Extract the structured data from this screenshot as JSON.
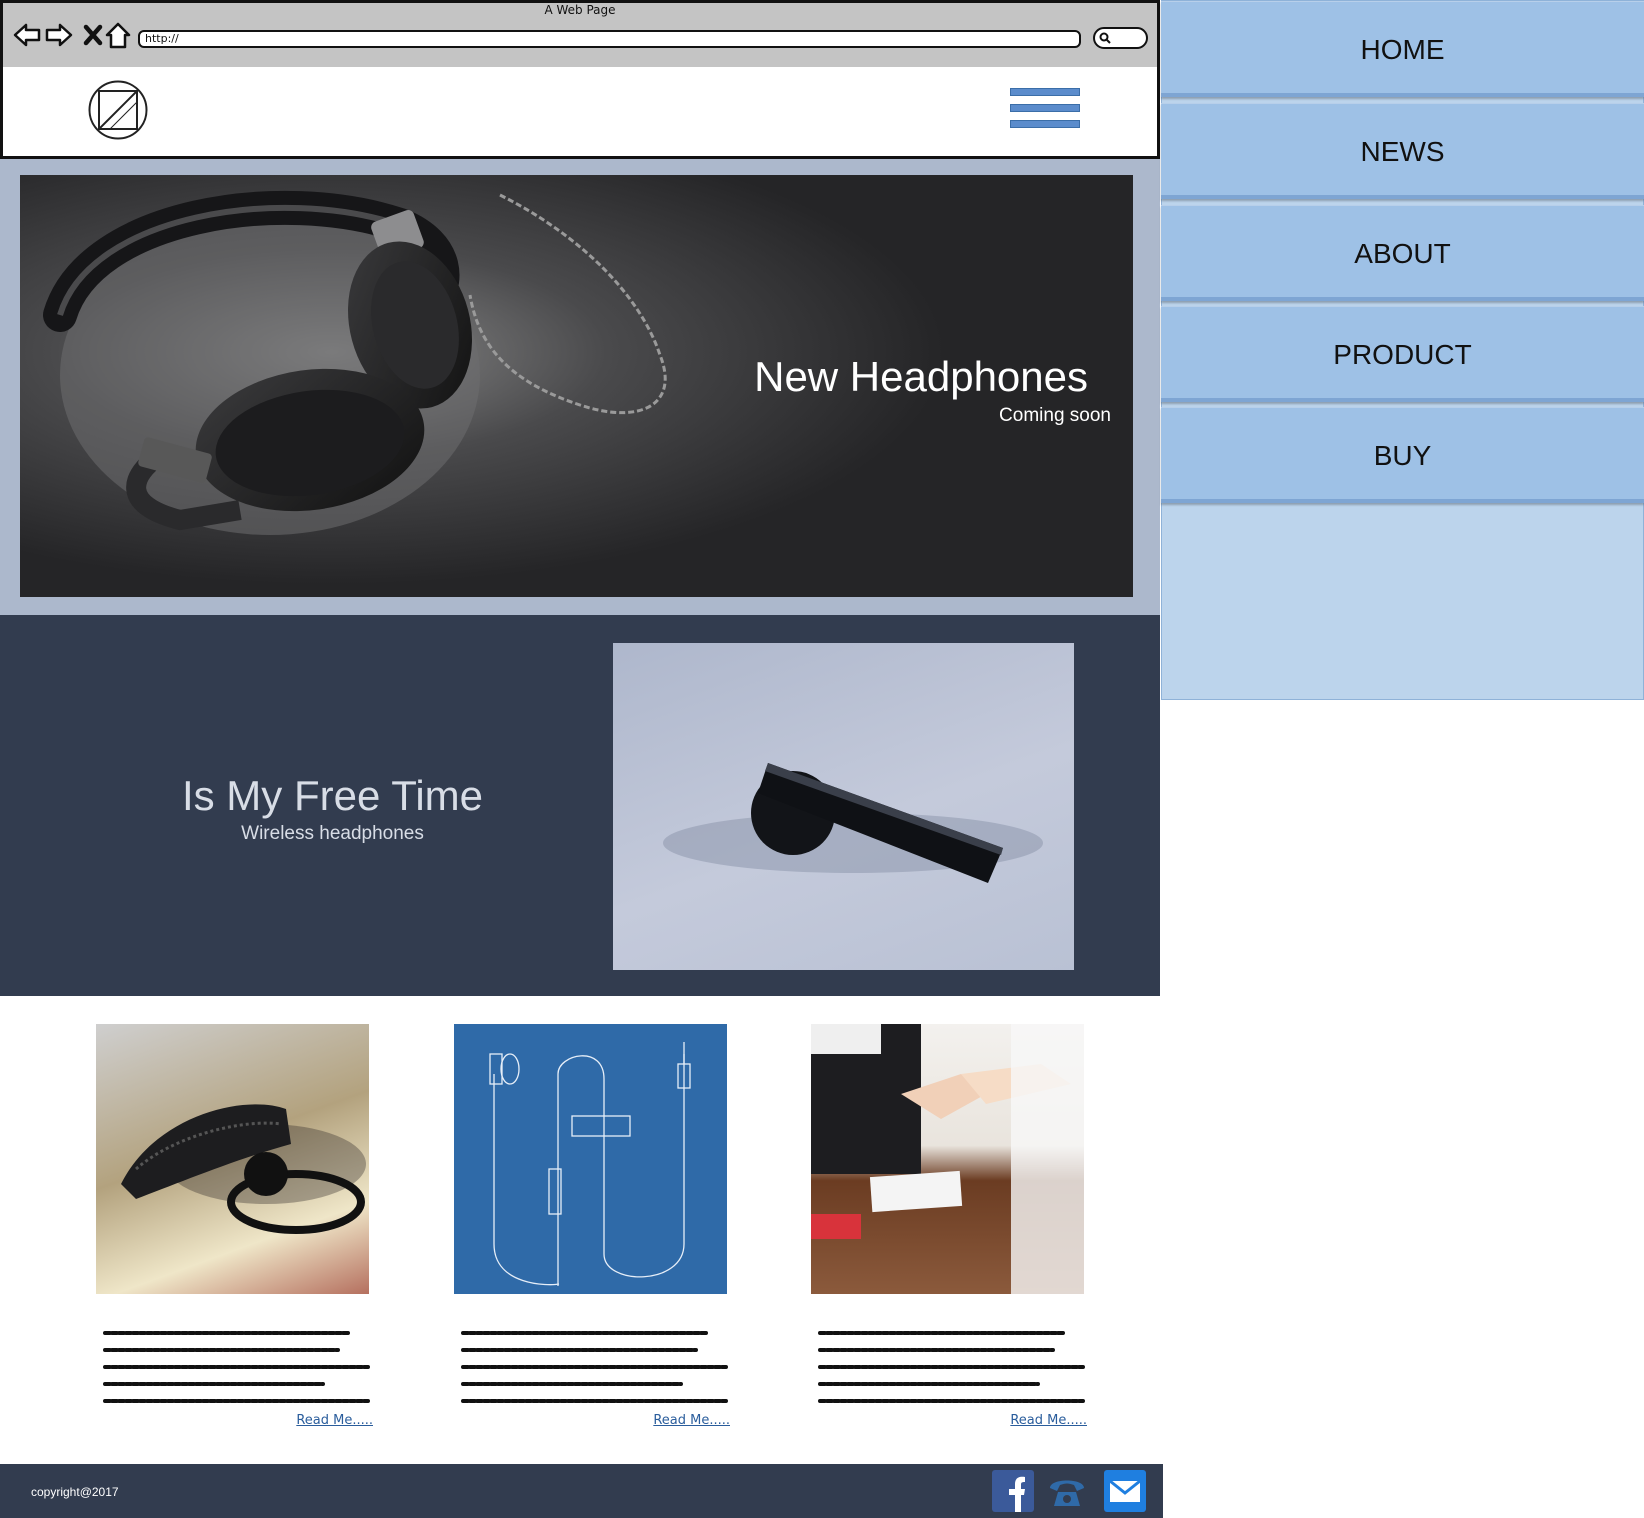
{
  "browser": {
    "window_title": "A Web Page",
    "url": "http://"
  },
  "hero": {
    "title": "New Headphones",
    "subtitle": "Coming soon"
  },
  "promo": {
    "title": "Is My Free Time",
    "subtitle": "Wireless headphones"
  },
  "cards": [
    {
      "read_more": "Read Me....."
    },
    {
      "read_more": "Read Me....."
    },
    {
      "read_more": "Read Me....."
    }
  ],
  "footer": {
    "copyright": "copyright@2017",
    "icons": [
      "facebook-icon",
      "phone-icon",
      "mail-icon"
    ]
  },
  "sidenav": {
    "items": [
      {
        "label": "HOME"
      },
      {
        "label": "NEWS"
      },
      {
        "label": "ABOUT"
      },
      {
        "label": "PRODUCT"
      },
      {
        "label": "BUY"
      }
    ]
  },
  "colors": {
    "nav_bg": "#9ec1e6",
    "dark_band": "#323c4f",
    "hero_frame": "#acb8cc",
    "blueprint": "#2f6aa8"
  }
}
